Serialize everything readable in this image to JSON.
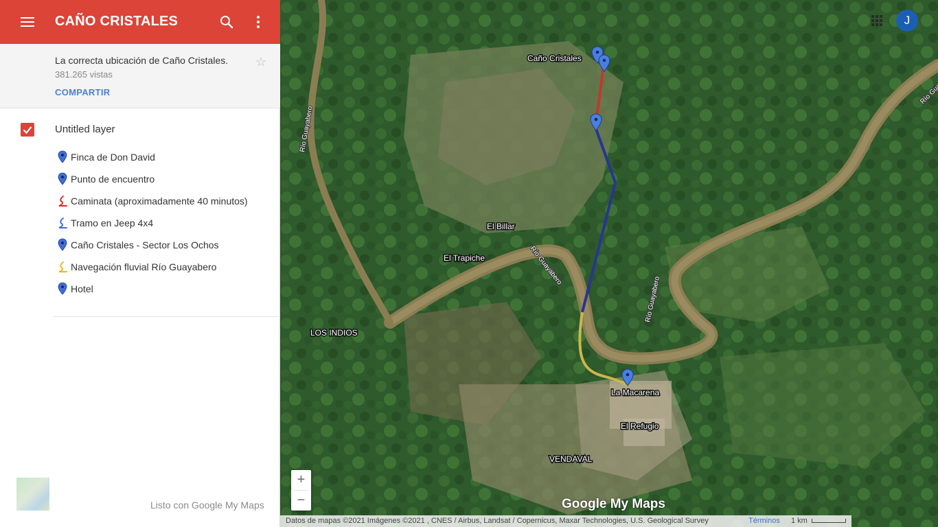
{
  "header": {
    "title": "CAÑO CRISTALES",
    "menu_icon": "menu-icon",
    "search_icon": "search-icon",
    "more_icon": "more-vert-icon",
    "accent_color": "#db4437"
  },
  "map_info": {
    "description": "La correcta ubicación de Caño Cristales.",
    "views": "381.265 vistas",
    "share_label": "COMPARTIR",
    "star_icon": "star-outline-icon"
  },
  "layer": {
    "title": "Untitled layer",
    "checked": true,
    "items": [
      {
        "label": "Finca de Don David",
        "icon": "blue-pin-icon"
      },
      {
        "label": "Punto de encuentro",
        "icon": "blue-pin-icon"
      },
      {
        "label": "Caminata (aproximadamente 40 minutos)",
        "icon": "red-route-icon"
      },
      {
        "label": "Tramo en Jeep 4x4",
        "icon": "blue-route-icon"
      },
      {
        "label": "Caño Cristales - Sector Los Ochos",
        "icon": "blue-pin-icon"
      },
      {
        "label": "Navegación fluvial Río Guayabero",
        "icon": "yellow-route-icon"
      },
      {
        "label": "Hotel",
        "icon": "blue-pin-icon"
      }
    ]
  },
  "footer": {
    "made_with": "Listo con Google My Maps"
  },
  "map": {
    "place_labels": {
      "cano_cristales": "Caño Cristales",
      "el_billar": "El Billar",
      "el_trapiche": "El Trapiche",
      "los_indios": "LOS INDIOS",
      "la_macarena": "La Macarena",
      "el_refugio": "El Refugio",
      "vendaval": "VENDAVAL"
    },
    "river_labels": {
      "guayabero_west": "Río Guayabero",
      "guayabero_center": "Río Guayabero",
      "guayabero_east": "Río Guayabero",
      "guayabero_ne": "Río Guayab"
    },
    "route_colors": {
      "walk": "#c0392b",
      "jeep": "#283593",
      "river": "#c8b84a"
    },
    "avatar_letter": "J",
    "zoom_in": "+",
    "zoom_out": "−",
    "logo": "Google My Maps",
    "attribution": "Datos de mapas ©2021 Imágenes ©2021 , CNES / Airbus, Landsat / Copernicus, Maxar Technologies, U.S. Geological Survey",
    "terms": "Términos",
    "scale": "1 km"
  }
}
